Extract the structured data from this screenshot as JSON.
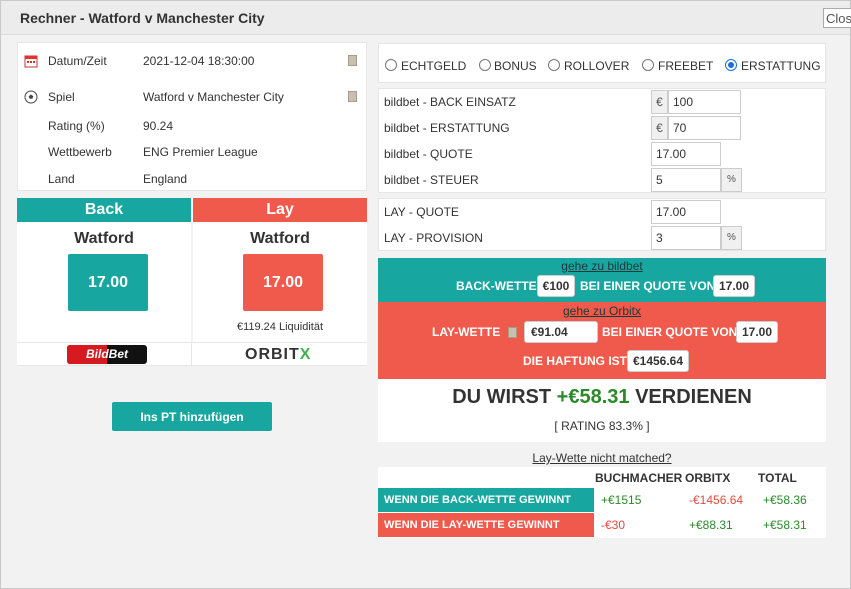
{
  "window": {
    "title": "Rechner - Watford v Manchester City",
    "close_label": "Close"
  },
  "info": [
    {
      "label": "Datum/Zeit",
      "value": "2021-12-04 18:30:00",
      "icon": "calendar-icon"
    },
    {
      "label": "Spiel",
      "value": "Watford v Manchester City",
      "icon": "soccer-ball-icon"
    },
    {
      "label": "Rating (%)",
      "value": "90.24"
    },
    {
      "label": "Wettbewerb",
      "value": "ENG Premier League"
    },
    {
      "label": "Land",
      "value": "England"
    }
  ],
  "back": {
    "header": "Back",
    "team": "Watford",
    "odds": "17.00",
    "color": "#17a7a0"
  },
  "lay": {
    "header": "Lay",
    "team": "Watford",
    "odds": "17.00",
    "liquidity": "€119.24 Liquidität",
    "color": "#ef5a4c"
  },
  "logos": {
    "bookmaker": "BildBet",
    "exchange_main": "ORBIT",
    "exchange_x": "X"
  },
  "add_pt_button": "Ins PT hinzufügen",
  "modes": [
    "ECHTGELD",
    "BONUS",
    "ROLLOVER",
    "FREEBET",
    "ERSTATTUNG"
  ],
  "selected_mode": "ERSTATTUNG",
  "calc": {
    "back_stake": {
      "label": "bildbet - BACK EINSATZ",
      "prefix": "€",
      "value": "100"
    },
    "refund": {
      "label": "bildbet - ERSTATTUNG",
      "prefix": "€",
      "value": "70"
    },
    "back_odds": {
      "label": "bildbet - QUOTE",
      "value": "17.00"
    },
    "tax": {
      "label": "bildbet - STEUER",
      "value": "5",
      "suffix": "%"
    },
    "lay_odds": {
      "label": "LAY - QUOTE",
      "value": "17.00"
    },
    "commission": {
      "label": "LAY - PROVISION",
      "value": "3",
      "suffix": "%"
    }
  },
  "instructions": {
    "back_link": "gehe zu bildbet",
    "back_prefix": "BACK-WETTE",
    "back_amount": "€100",
    "back_mid": "BEI EINER QUOTE VON",
    "back_odds": "17.00",
    "lay_link": "gehe zu Orbitx",
    "lay_prefix": "LAY-WETTE",
    "lay_amount": "€91.04",
    "lay_mid": "BEI EINER QUOTE VON",
    "lay_odds": "17.00",
    "liability_label": "DIE HAFTUNG IST",
    "liability": "€1456.64"
  },
  "profit": {
    "prefix": "DU WIRST",
    "amount": "+€58.31",
    "suffix": "VERDIENEN",
    "rating": "[ RATING 83.3% ]"
  },
  "not_matched_link": "Lay-Wette nicht matched?",
  "results": {
    "headers": [
      "BUCHMACHER",
      "ORBITX",
      "TOTAL"
    ],
    "rows": [
      {
        "label": "WENN DIE BACK-WETTE GEWINNT",
        "bookmaker": "+€1515",
        "exchange": "-€1456.64",
        "total": "+€58.36"
      },
      {
        "label": "WENN DIE LAY-WETTE GEWINNT",
        "bookmaker": "-€30",
        "exchange": "+€88.31",
        "total": "+€58.31"
      }
    ]
  }
}
